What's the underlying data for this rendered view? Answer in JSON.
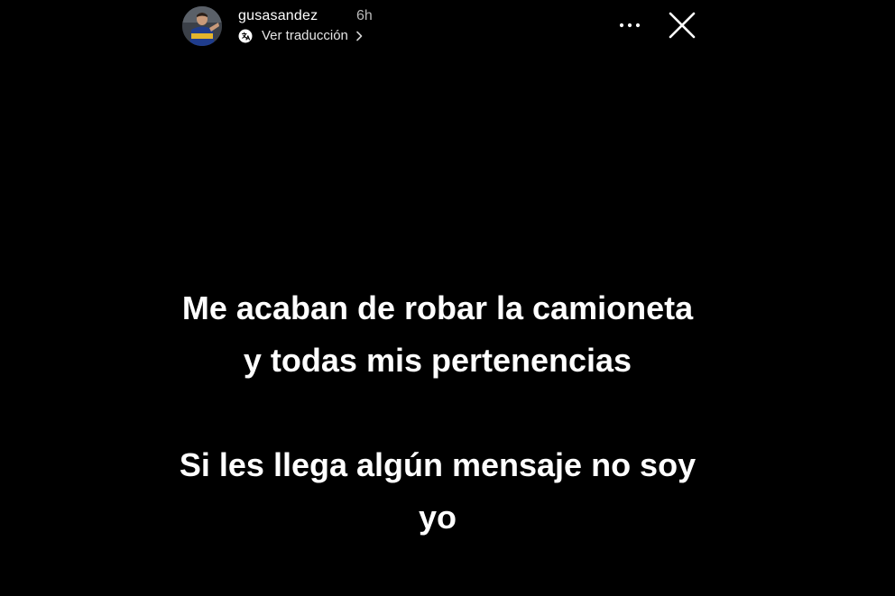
{
  "story": {
    "username": "gusasandez",
    "time_ago": "6h",
    "translate_label": "Ver traducción",
    "icons": {
      "avatar": "profile-avatar",
      "translate": "translate-icon",
      "chevron": "chevron-right-icon",
      "more": "more-options-icon",
      "close": "close-icon"
    },
    "message": {
      "paragraph_1": "Me acaban de robar la camioneta y todas mis pertenencias",
      "paragraph_2": "Si les llega algún mensaje no soy yo"
    },
    "colors": {
      "background": "#000000",
      "text": "#ffffff",
      "muted": "#b8b8b8"
    }
  }
}
